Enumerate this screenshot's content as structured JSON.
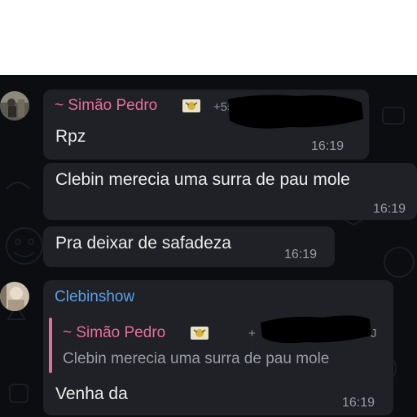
{
  "messages": [
    {
      "sender": "~ Simão Pedro",
      "phone": "+55",
      "lines": [
        "Rpz",
        "Clebin merecia uma surra de pau mole",
        "Pra deixar de safadeza"
      ],
      "times": [
        "16:19",
        "16:19",
        "16:19"
      ]
    },
    {
      "sender": "Clebinshow",
      "reply": {
        "sender": "~ Simão Pedro",
        "phone": "+",
        "phone_suffix": "J",
        "text": "Clebin merecia uma surra de pau mole"
      },
      "text": "Venha da",
      "time": "16:19"
    }
  ],
  "colors": {
    "background": "#0b0d11",
    "bubble": "#1f2126",
    "sender_pink": "#e76e9b",
    "sender_blue": "#5aa0e6"
  },
  "icons": [
    "avatar",
    "sender-emoji-icon"
  ]
}
